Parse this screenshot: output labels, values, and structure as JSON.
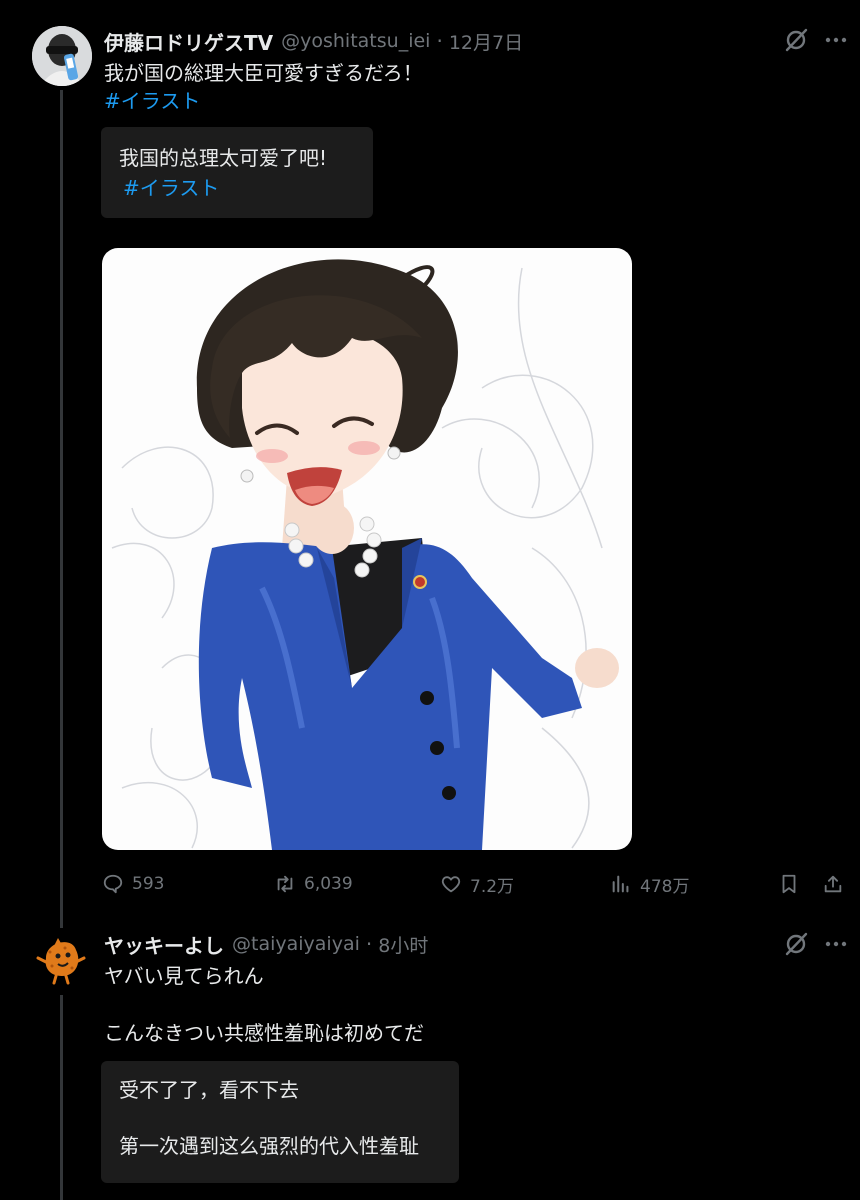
{
  "tweet": {
    "author_name": "伊藤ロドリゲスTV",
    "author_handle": "@yoshitatsu_iei",
    "separator": "·",
    "time": "12月7日",
    "text": "我が国の総理大臣可愛すぎるだろ！",
    "hashtag": "#イラスト",
    "translation_text": "我国的总理太可爱了吧!",
    "translation_hashtag": "#イラスト",
    "stats": {
      "replies": "593",
      "retweets": "6,039",
      "likes": "7.2万",
      "views": "478万"
    }
  },
  "reply": {
    "author_name": "ヤッキーよし",
    "author_handle": "@taiyaiyaiyai",
    "separator": "·",
    "time": "8小时",
    "text_line1": "ヤバい見てられん",
    "text_line2": "こんなきつい共感性羞恥は初めてだ",
    "translation_line1": "受不了了，看不下去",
    "translation_line2": "第一次遇到这么强烈的代入性羞耻"
  },
  "colors": {
    "background": "#000000",
    "text": "#e7e9ea",
    "muted": "#71767b",
    "accent": "#1d9bf0",
    "translation_bg": "#1c1c1c",
    "jacket": "#2f55b8",
    "hair": "#2d2620"
  },
  "icons": [
    "grok-icon",
    "more-icon",
    "reply-icon",
    "retweet-icon",
    "like-icon",
    "views-icon",
    "bookmark-icon",
    "share-icon"
  ]
}
